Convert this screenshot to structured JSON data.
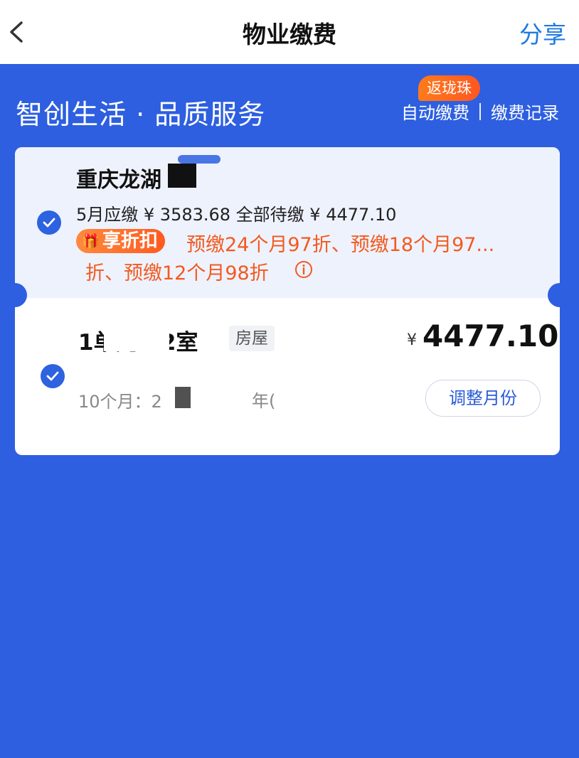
{
  "nav": {
    "title": "物业缴费",
    "share_label": "分享"
  },
  "header": {
    "slogan": "智创生活 · 品质服务",
    "badge": "返珑珠",
    "auto_pay": "自动缴费",
    "records": "缴费记录"
  },
  "card": {
    "community": "重庆龙湖",
    "summary": "5月应缴 ¥ 3583.68 全部待缴 ¥ 4477.10",
    "discount_tag": "享折扣",
    "discount_line1": "预缴24个月97折、预缴18个月97...",
    "discount_line2": "折、预缴12个月98折",
    "room": "1单元 02室",
    "room_type": "房屋",
    "currency": "¥",
    "amount": "4477.10",
    "months": "10个月：2",
    "months_tail": "年(",
    "adjust_label": "调整月份"
  },
  "colors": {
    "primary_blue": "#2d5fe0",
    "accent_orange": "#f25a1f",
    "share_blue": "#1f7ae0"
  }
}
